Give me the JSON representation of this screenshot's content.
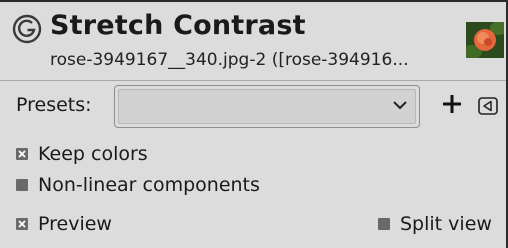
{
  "header": {
    "title": "Stretch Contrast",
    "subtitle": "rose-3949167__340.jpg-2 ([rose-394916..."
  },
  "presets": {
    "label": "Presets:",
    "value": ""
  },
  "options": {
    "keep_colors": {
      "label": "Keep colors",
      "checked": true
    },
    "non_linear": {
      "label": "Non-linear components",
      "checked": false
    },
    "preview": {
      "label": "Preview",
      "checked": true
    },
    "split_view": {
      "label": "Split view",
      "checked": false
    }
  },
  "icons": [
    "gimp-filter-icon",
    "image-thumbnail",
    "chevron-down-icon",
    "add-icon",
    "menu-icon"
  ],
  "colors": {
    "background": "#dcdcdc",
    "checkbox": "#6a6a6a",
    "text": "#1a1a1a"
  }
}
